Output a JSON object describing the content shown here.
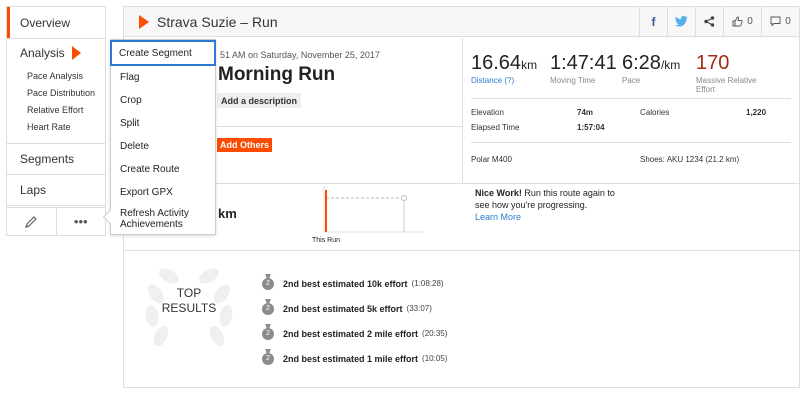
{
  "sidebar": {
    "overview": "Overview",
    "analysis": {
      "label": "Analysis",
      "items": [
        "Pace Analysis",
        "Pace Distribution",
        "Relative Effort",
        "Heart Rate"
      ]
    },
    "segments": "Segments",
    "laps": "Laps",
    "tools": {
      "edit_icon": "pencil-icon",
      "more": "•••"
    }
  },
  "menu": {
    "items": [
      "Create Segment",
      "Flag",
      "Crop",
      "Split",
      "Delete",
      "Create Route",
      "Export GPX",
      "Refresh Activity Achievements"
    ],
    "selected": "Create Segment"
  },
  "header": {
    "title": "Strava Suzie – Run",
    "kudos_count": "0",
    "comment_count": "0",
    "icons": [
      "facebook-icon",
      "twitter-icon",
      "share-icon",
      "kudos-icon",
      "comment-icon"
    ]
  },
  "activity": {
    "date_line": "51 AM on Saturday, November 25, 2017",
    "title": "Morning Run",
    "add_description": "Add a description",
    "add_others": "Add Others"
  },
  "stats": {
    "distance": {
      "value": "16.64",
      "unit": "km",
      "label": "Distance (?)"
    },
    "moving_time": {
      "value": "1:47:41",
      "label": "Moving Time"
    },
    "pace": {
      "value": "6:28",
      "unit": "/km",
      "label": "Pace"
    },
    "relative_effort": {
      "value": "170",
      "label": "Massive Relative Effort"
    },
    "elevation": {
      "label": "Elevation",
      "value": "74m"
    },
    "calories": {
      "label": "Calories",
      "value": "1,220"
    },
    "elapsed_time": {
      "label": "Elapsed Time",
      "value": "1:57:04"
    },
    "device": "Polar M400",
    "shoes": "Shoes: AKU 1234 (21.2 km)"
  },
  "comparison": {
    "km_fragment": "km",
    "chart_label": "This Run",
    "nice_work_bold": "Nice Work!",
    "nice_work_text": "Run this route again to see how you're progressing.",
    "learn_more": "Learn More"
  },
  "top_results": {
    "title_line1": "TOP",
    "title_line2": "RESULTS",
    "items": [
      {
        "medal": "2",
        "text": "2nd best estimated 10k effort",
        "time": "(1:08:28)"
      },
      {
        "medal": "2",
        "text": "2nd best estimated 5k effort",
        "time": "(33:07)"
      },
      {
        "medal": "2",
        "text": "2nd best estimated 2 mile effort",
        "time": "(20:35)"
      },
      {
        "medal": "2",
        "text": "2nd best estimated 1 mile effort",
        "time": "(10:05)"
      }
    ]
  },
  "colors": {
    "accent": "#fc4c02",
    "link": "#2c7bd2",
    "effort": "#a42b14",
    "selection": "#2c7bd2"
  }
}
